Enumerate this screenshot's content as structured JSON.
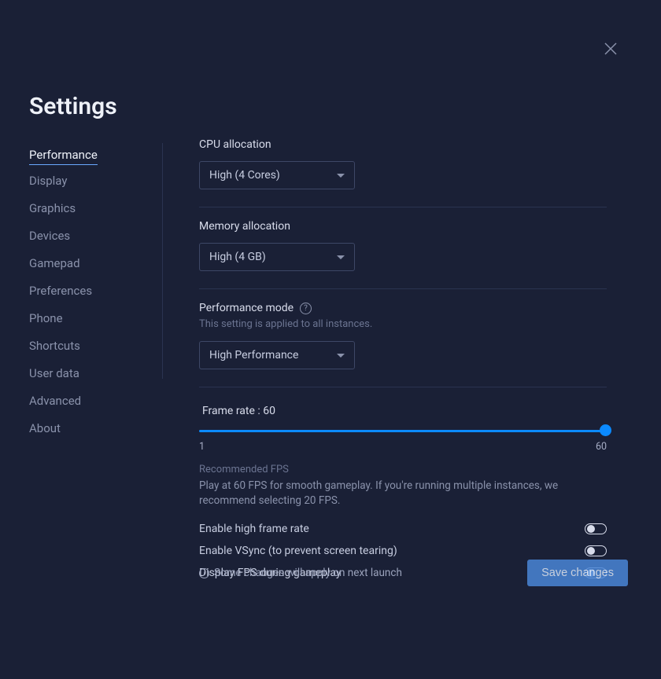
{
  "title": "Settings",
  "sidebar": {
    "items": [
      {
        "label": "Performance",
        "active": true
      },
      {
        "label": "Display"
      },
      {
        "label": "Graphics"
      },
      {
        "label": "Devices"
      },
      {
        "label": "Gamepad"
      },
      {
        "label": "Preferences"
      },
      {
        "label": "Phone"
      },
      {
        "label": "Shortcuts"
      },
      {
        "label": "User data"
      },
      {
        "label": "Advanced"
      },
      {
        "label": "About"
      }
    ]
  },
  "cpu": {
    "label": "CPU allocation",
    "value": "High (4 Cores)"
  },
  "memory": {
    "label": "Memory allocation",
    "value": "High (4 GB)"
  },
  "perfmode": {
    "label": "Performance mode",
    "sublabel": "This setting is applied to all instances.",
    "value": "High Performance"
  },
  "fps": {
    "label": "Frame rate : 60",
    "min": "1",
    "max": "60",
    "rec_title": "Recommended FPS",
    "rec_desc": "Play at 60 FPS for smooth gameplay. If you're running multiple instances, we recommend selecting 20 FPS."
  },
  "toggles": {
    "hifps": "Enable high frame rate",
    "vsync": "Enable VSync (to prevent screen tearing)",
    "showfps": "Display FPS during gameplay"
  },
  "footer": {
    "note": "Some changes will apply on next launch",
    "save": "Save changes"
  }
}
